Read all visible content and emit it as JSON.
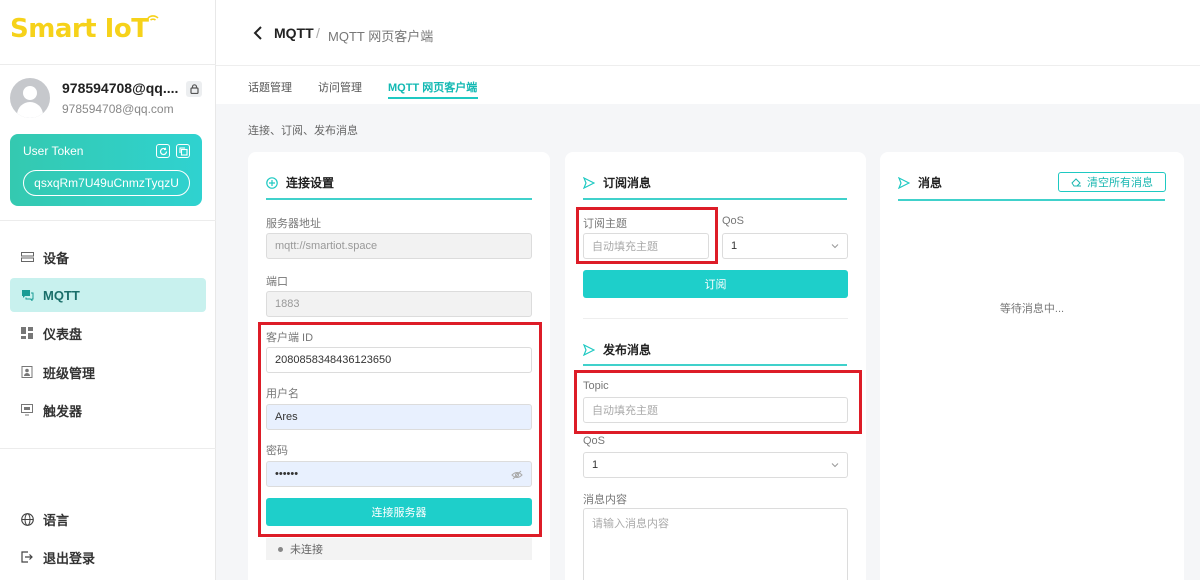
{
  "sidebar": {
    "logo": "Smart IoT",
    "user": {
      "name": "978594708@qq....",
      "email": "978594708@qq.com"
    },
    "token": {
      "label": "User Token",
      "value": "qsxqRm7U49uCnmzTyqzU"
    },
    "nav": [
      {
        "label": "设备",
        "icon": "device-icon"
      },
      {
        "label": "MQTT",
        "icon": "chat-icon"
      },
      {
        "label": "仪表盘",
        "icon": "dashboard-icon"
      },
      {
        "label": "班级管理",
        "icon": "class-icon"
      },
      {
        "label": "触发器",
        "icon": "trigger-icon"
      }
    ],
    "language": "语言",
    "logout": "退出登录"
  },
  "breadcrumb": {
    "current": "MQTT",
    "separator": "/",
    "page": "MQTT 网页客户端"
  },
  "tabs": [
    "话题管理",
    "访问管理",
    "MQTT 网页客户端"
  ],
  "section_desc": "连接、订阅、发布消息",
  "connection": {
    "title": "连接设置",
    "server_label": "服务器地址",
    "server_value": "mqtt://smartiot.space",
    "port_label": "端口",
    "port_value": "1883",
    "client_id_label": "客户端 ID",
    "client_id_value": "2080858348436123650",
    "username_label": "用户名",
    "username_value": "Ares",
    "password_label": "密码",
    "password_value": "••••••",
    "connect_button": "连接服务器",
    "status": "未连接"
  },
  "subscribe": {
    "title": "订阅消息",
    "topic_label": "订阅主题",
    "topic_placeholder": "自动填充主题",
    "qos_label": "QoS",
    "qos_value": "1",
    "subscribe_button": "订阅"
  },
  "publish": {
    "title": "发布消息",
    "topic_label": "Topic",
    "topic_placeholder": "自动填充主题",
    "qos_label": "QoS",
    "qos_value": "1",
    "content_label": "消息内容",
    "content_placeholder": "请输入消息内容"
  },
  "messages": {
    "title": "消息",
    "clear_button": "清空所有消息",
    "waiting": "等待消息中..."
  },
  "colors": {
    "accent": "#1ecfca",
    "highlight": "#dd1c27",
    "logo": "#f6d21a"
  }
}
